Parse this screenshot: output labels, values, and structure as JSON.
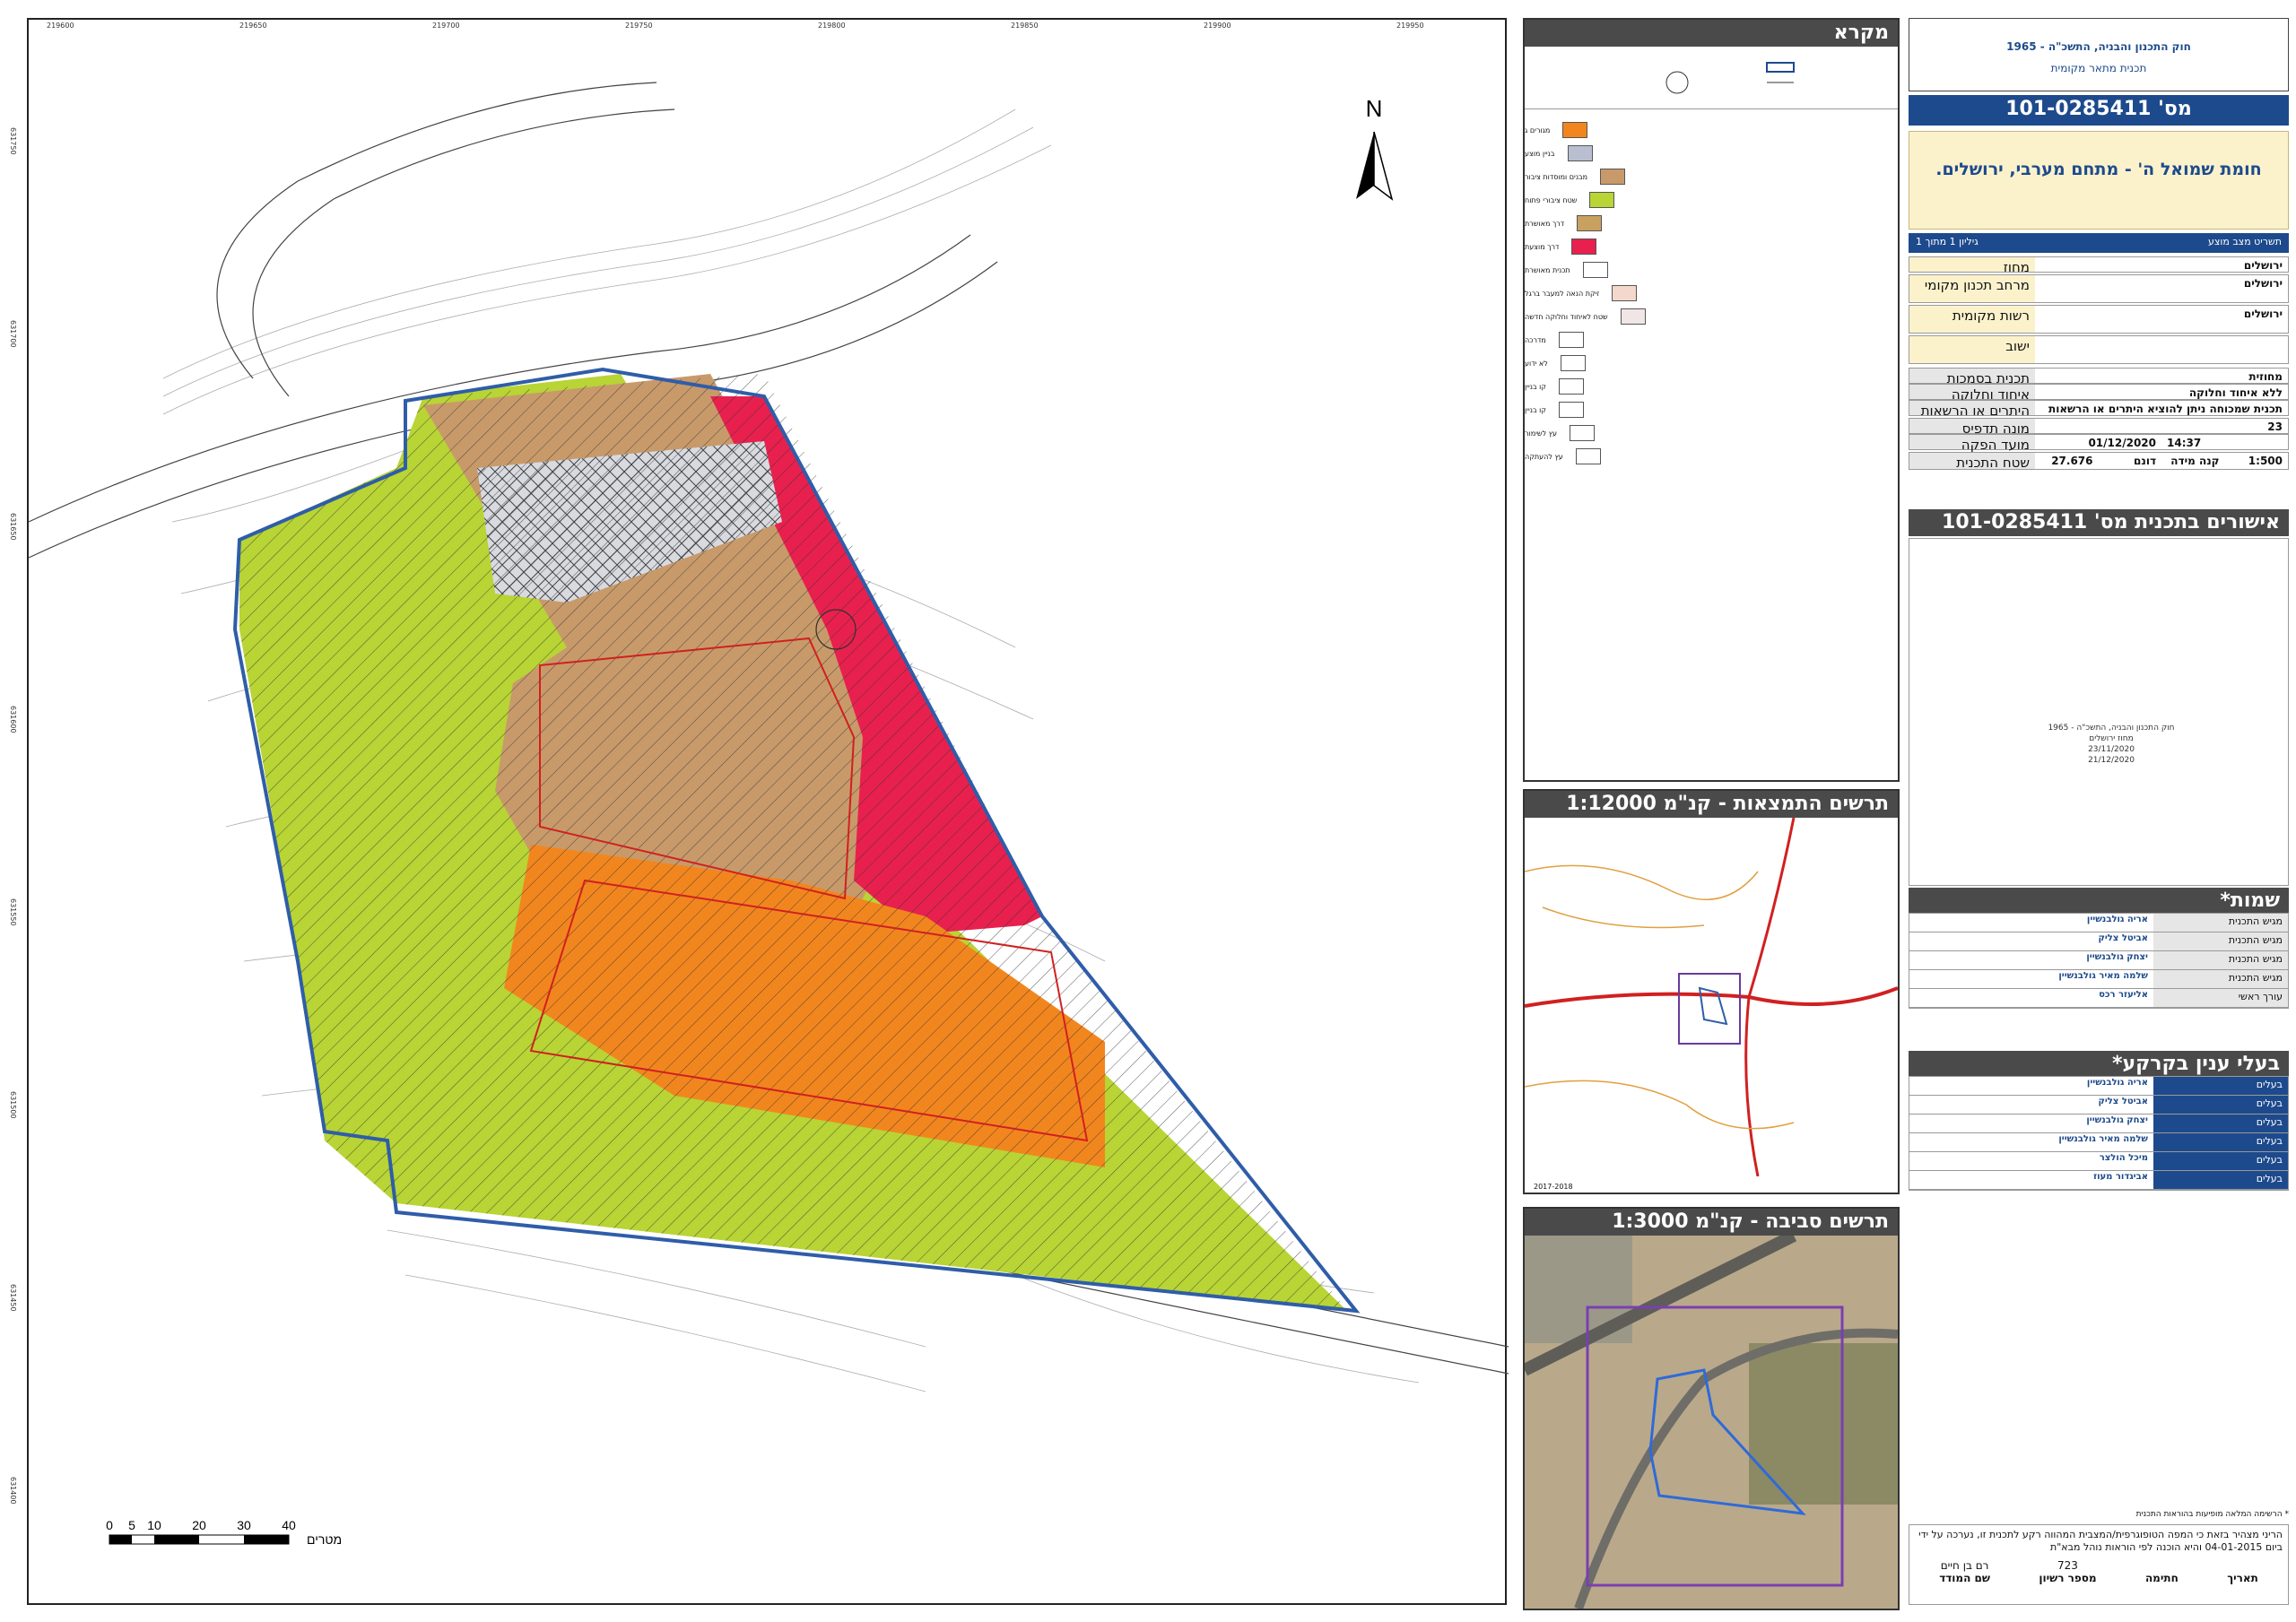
{
  "map": {
    "north_label": "N",
    "scale_ticks": [
      "0",
      "5",
      "10",
      "20",
      "30",
      "40"
    ],
    "scale_unit": "מטרים",
    "coords_top": [
      "219600",
      "219650",
      "219700",
      "219750",
      "219800",
      "219850",
      "219900",
      "219950"
    ],
    "coords_left": [
      "631750",
      "631700",
      "631650",
      "631600",
      "631550",
      "631500",
      "631450",
      "631400"
    ],
    "parcel_colors": {
      "plan_boundary": "#2f5da8",
      "residential_orange": "#f2861e",
      "open_space_green": "#b8d435",
      "public_building_brown": "#c89a6a",
      "road_red": "#e8204e",
      "building_line": "#d02020"
    }
  },
  "legend": {
    "title": "מקרא",
    "items": [
      {
        "label": "מגורים ג",
        "color": "#f2861e"
      },
      {
        "label": "בניין מוצע",
        "color": "#b9bfd0"
      },
      {
        "label": "מבנים ומוסדות ציבור",
        "color": "#c89a6a"
      },
      {
        "label": "שטח ציבורי פתוח",
        "color": "#b8d435"
      },
      {
        "label": "דרך מאושרת",
        "color": "#c8a060"
      },
      {
        "label": "דרך מוצעת",
        "color": "#e8204e"
      },
      {
        "label": "תכנית מאושרת",
        "color": "#ffffff"
      },
      {
        "label": "זיקת הנאה למעבר ברגל",
        "color": "#f4d8cc"
      },
      {
        "label": "שטח לאיחוד וחלוקה חדשה",
        "color": "#f0e6e6"
      },
      {
        "label": "מדרכה",
        "color": "#ffffff"
      },
      {
        "label": "לא ידוע",
        "color": "#ffffff"
      },
      {
        "label": "קו בניין",
        "color": "#ffffff"
      },
      {
        "label": "קו בניין",
        "color": "#ffffff"
      },
      {
        "label": "עץ לשימור",
        "color": "#ffffff"
      },
      {
        "label": "עץ להעתקה",
        "color": "#ffffff"
      }
    ]
  },
  "inset_location": {
    "title": "תרשים התמצאות - קנ\"מ 1:12000",
    "footer": "2017-2018"
  },
  "inset_area": {
    "title": "תרשים סביבה - קנ\"מ 1:3000"
  },
  "header": {
    "law": "חוק התכנון והבניה, התשכ\"ה - 1965",
    "plan_type": "תכנית מתאר מקומית",
    "plan_number": "מס' 101-0285411",
    "plan_name": "חומת שמואל ה' - מתחם מערבי, ירושלים.",
    "sheet_label": "תשריט מצב מוצע",
    "sheet_info": "גיליון 1 מתוך 1"
  },
  "details": [
    {
      "label": "מחוז",
      "value": "ירושלים"
    },
    {
      "label": "מרחב תכנון מקומי",
      "value": "ירושלים"
    },
    {
      "label": "רשות מקומית",
      "value": "ירושלים"
    },
    {
      "label": "ישוב",
      "value": ""
    },
    {
      "label": "תכנית בסמכות",
      "value": "מחוזית"
    },
    {
      "label": "איחוד וחלוקה",
      "value": "ללא איחוד וחלוקה"
    },
    {
      "label": "היתרים או הרשאות",
      "value": "תכנית שמכוחה ניתן להוציא היתרים או הרשאות"
    },
    {
      "label": "מונה תדפיס התשריט",
      "value": "23"
    },
    {
      "label": "מועד הפקה",
      "value": "01/12/2020",
      "extra": "14:37"
    },
    {
      "label": "שטח התכנית",
      "value": "27.676",
      "unit": "דונם",
      "scale_label": "קנה מידה",
      "scale": "1:500"
    }
  ],
  "approvals": {
    "title": "אישורים בתכנית מס' 101-0285411",
    "stamp_lines": [
      "חוק התכנון והבניה, התשכ\"ה - 1965",
      "מחוז ירושלים",
      "23/11/2020",
      "21/12/2020"
    ]
  },
  "names": {
    "title": "שמות*",
    "rows": [
      {
        "role": "מגיש התכנית",
        "name": "אריה גולבנשיין"
      },
      {
        "role": "מגיש התכנית",
        "name": "אביטל צליק"
      },
      {
        "role": "מגיש התכנית",
        "name": "יצחק גולבנשיין"
      },
      {
        "role": "מגיש התכנית",
        "name": "שלמה מאיר גולבנשיין"
      },
      {
        "role": "עורך ראשי",
        "name": "אליעזר רכס"
      }
    ]
  },
  "owners": {
    "title": "בעלי ענין בקרקע*",
    "rows": [
      {
        "role": "בעלים",
        "name": "אריה גולבנשיין"
      },
      {
        "role": "בעלים",
        "name": "אביטל צליק"
      },
      {
        "role": "בעלים",
        "name": "יצחק גולבנשיין"
      },
      {
        "role": "בעלים",
        "name": "שלמה מאיר גולבנשיין"
      },
      {
        "role": "בעלים",
        "name": "מיכל הולצר"
      },
      {
        "role": "בעלים",
        "name": "אביגדור מעוז"
      }
    ]
  },
  "surveyor": {
    "note": "* הרשימה המלאה מופיעות בהוראות התכנית",
    "text": "הריני מצהיר בזאת כי המפה הטופוגרפית/המצבית המהווה רקע לתכנית זו, נערכה על ידי ביום 04-01-2015 והיא הוכנה לפי הוראות נוהל מבא\"ת",
    "surveyor_name": "רם בן חיים",
    "license": "723",
    "col_name": "שם המודד",
    "col_license": "מספר רשיון",
    "col_sign": "חתימה",
    "col_date": "תאריך"
  }
}
